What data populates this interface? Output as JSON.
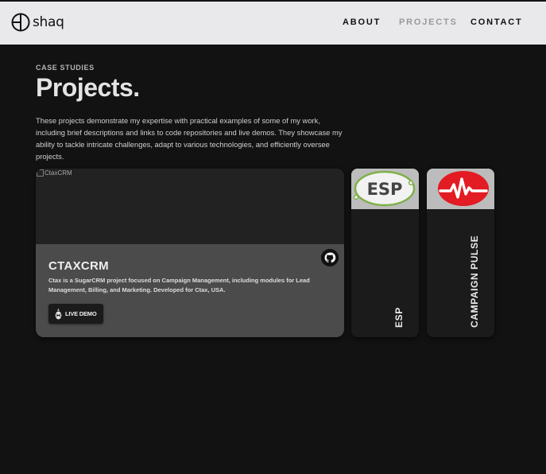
{
  "brand": {
    "name": "shaq",
    "logo_icon": "circle-d-logo-icon"
  },
  "nav": {
    "items": [
      {
        "label": "ABOUT",
        "active": false
      },
      {
        "label": "PROJECTS",
        "active": true
      },
      {
        "label": "CONTACT",
        "active": false
      }
    ]
  },
  "section": {
    "eyebrow": "CASE STUDIES",
    "title": "Projects.",
    "intro": "These projects demonstrate my expertise with practical examples of some of my work, including brief descriptions and links to code repositories and live demos. They showcase my ability to tackle intricate challenges, adapt to various technologies, and efficiently oversee projects."
  },
  "projects": [
    {
      "name": "CTAXCRM",
      "image_alt": "CtaxCRM",
      "description": "Ctax is a SugarCRM project focused on Campaign Management, including modules for Lead Management, Billing, and Marketing. Developed for Ctax, USA.",
      "github_icon": "github-icon",
      "live_demo_label": "LIVE DEMO",
      "live_demo_icon": "pineapple-icon"
    },
    {
      "name": "ESP",
      "thumb_text": "ESP"
    },
    {
      "name": "CAMPAIGN PULSE",
      "thumb_icon": "heartbeat-icon"
    }
  ],
  "colors": {
    "background": "#121212",
    "nav_background": "#e9e9eb",
    "nav_active": "#9a9a9a",
    "card_body": "#4b4b4b",
    "side_card": "#1b1b1b",
    "esp_green": "#7fb04a",
    "pulse_red": "#e31b23"
  }
}
